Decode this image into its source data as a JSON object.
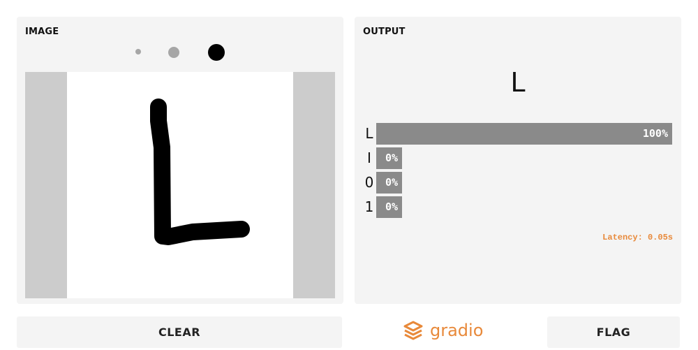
{
  "input_panel": {
    "title": "IMAGE",
    "brush_sizes": [
      "small",
      "medium",
      "large"
    ],
    "selected_brush": "large",
    "drawn_character": "L"
  },
  "output_panel": {
    "title": "OUTPUT",
    "predicted_label": "L",
    "confidences": [
      {
        "label": "L",
        "percent_text": "100%",
        "value": 1.0
      },
      {
        "label": "I",
        "percent_text": "0%",
        "value": 0.0
      },
      {
        "label": "0",
        "percent_text": "0%",
        "value": 0.0
      },
      {
        "label": "1",
        "percent_text": "0%",
        "value": 0.0
      }
    ],
    "latency": "Latency: 0.05s"
  },
  "buttons": {
    "clear": "CLEAR",
    "flag": "FLAG"
  },
  "brand": {
    "name": "gradio",
    "icon": "gradio-logo-icon"
  },
  "colors": {
    "accent": "#e8893a",
    "panel_bg": "#f4f4f4",
    "bar": "#8a8a8a",
    "canvas_side": "#cccccc"
  }
}
